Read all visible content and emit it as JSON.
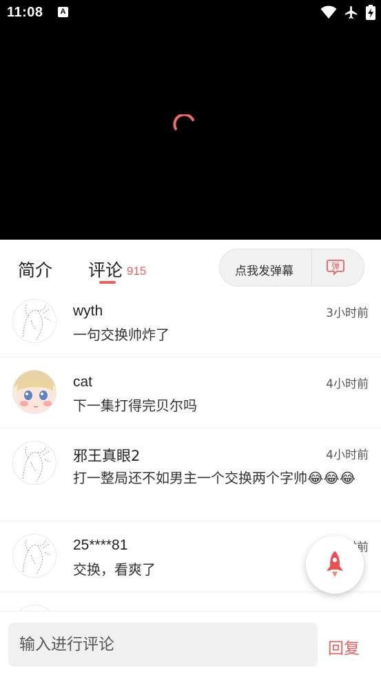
{
  "status_bar": {
    "time": "11:08",
    "notification_badge": "A",
    "icons": [
      "wifi-icon",
      "airplane-icon",
      "battery-charging-icon"
    ]
  },
  "video": {
    "state": "loading",
    "spinner_color": "#ef5e5e"
  },
  "tabs": {
    "intro_label": "简介",
    "comments_label": "评论",
    "comments_count": "915",
    "active": "comments",
    "accent": "#ef5e5e"
  },
  "danmaku": {
    "label": "点我发弹幕",
    "icon": "danmaku-icon",
    "icon_text": "弹"
  },
  "comments": [
    {
      "user": "wyth",
      "time": "3小时前",
      "text": "一句交换帅炸了",
      "avatar": "sketch-avatar"
    },
    {
      "user": "cat",
      "time": "4小时前",
      "text": "下一集打得完贝尔吗",
      "avatar": "anime-girl-avatar"
    },
    {
      "user": "邪王真眼2",
      "time": "4小时前",
      "text": "打一整局还不如男主一个交换两个字帅😂😂😂",
      "avatar": "sketch-avatar"
    },
    {
      "user": "25****81",
      "time": "4小时前",
      "text": "交换，看爽了",
      "avatar": "sketch-avatar"
    }
  ],
  "fab": {
    "icon": "rocket-icon"
  },
  "composer": {
    "placeholder": "输入进行评论",
    "reply_label": "回复"
  }
}
